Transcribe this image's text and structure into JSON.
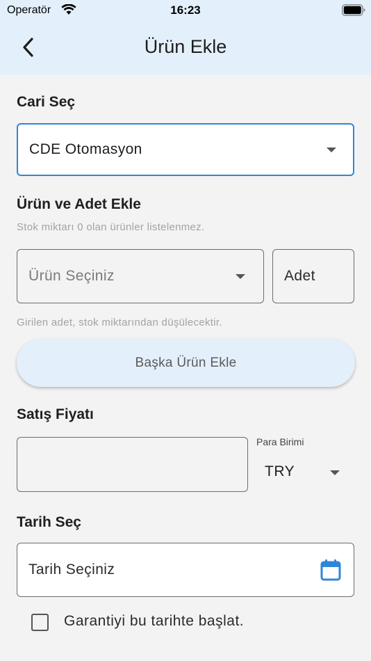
{
  "status_bar": {
    "carrier": "Operatör",
    "time": "16:23"
  },
  "header": {
    "title": "Ürün Ekle"
  },
  "cari": {
    "label": "Cari Seç",
    "selected": "CDE Otomasyon"
  },
  "urun": {
    "label": "Ürün ve Adet Ekle",
    "helper_top": "Stok miktarı 0 olan ürünler listelenmez.",
    "product_placeholder": "Ürün Seçiniz",
    "quantity_placeholder": "Adet",
    "helper_bottom": "Girilen adet, stok miktarından düşülecektir.",
    "add_button": "Başka Ürün Ekle"
  },
  "fiyat": {
    "label": "Satış Fiyatı",
    "price_value": "",
    "currency_label": "Para Birimi",
    "currency_value": "TRY"
  },
  "tarih": {
    "label": "Tarih Seç",
    "placeholder": "Tarih Seçiniz",
    "warranty_checkbox_label": "Garantiyi bu tarihte başlat.",
    "warranty_checked": false
  },
  "colors": {
    "accent": "#2f86da",
    "header_bg": "#e3f0fb",
    "page_bg": "#f3f3f3"
  }
}
